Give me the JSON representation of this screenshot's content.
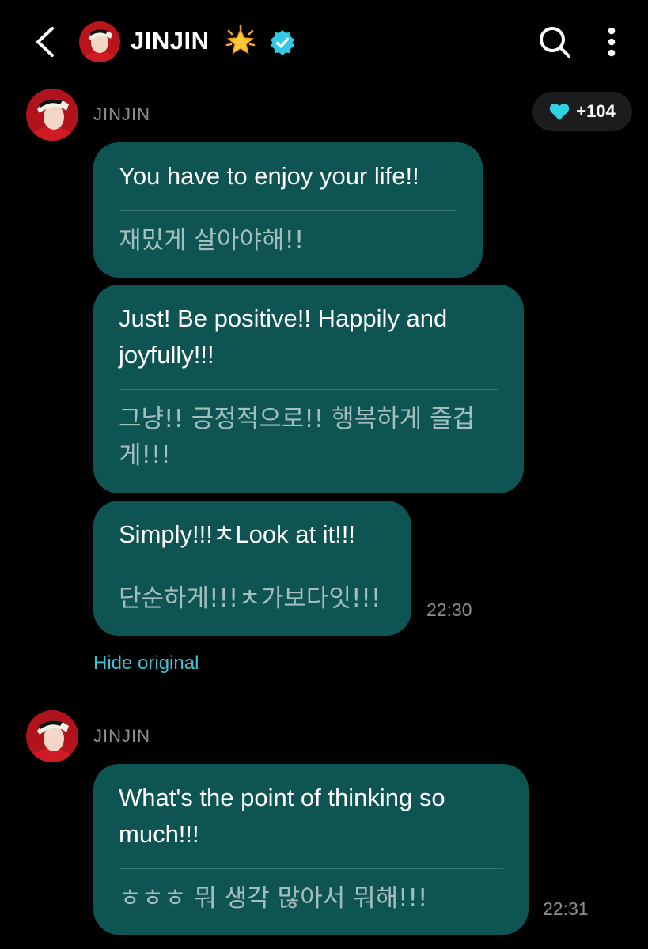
{
  "header": {
    "title": "JINJIN",
    "icons": [
      "back-icon",
      "glowing-star-icon",
      "verified-badge-icon",
      "search-icon",
      "more-vert-icon"
    ]
  },
  "likes": {
    "count": "+104",
    "icon": "heart-icon",
    "color": "#2fd3e0"
  },
  "groups": [
    {
      "sender": "JINJIN",
      "messages": [
        {
          "text": "You have to enjoy your life!!",
          "original": "재밌게 살아야해!!"
        },
        {
          "text": "Just! Be positive!! Happily and joyfully!!!",
          "original": "그냥!! 긍정적으로!! 행복하게 즐겁게!!!"
        },
        {
          "text": "Simply!!!ㅊLook at it!!!",
          "original": "단순하게!!!ㅊ가보다잇!!!"
        }
      ],
      "time": "22:30",
      "toggle_label": "Hide original"
    },
    {
      "sender": "JINJIN",
      "messages": [
        {
          "text": "What's the point of thinking so much!!!",
          "original": "ㅎㅎㅎ 뭐 생각 많아서 뭐해!!!"
        }
      ],
      "time": "22:31"
    }
  ],
  "colors": {
    "bubble": "#0d5452",
    "accent": "#3bc4d6",
    "verified": "#35c8e8"
  }
}
